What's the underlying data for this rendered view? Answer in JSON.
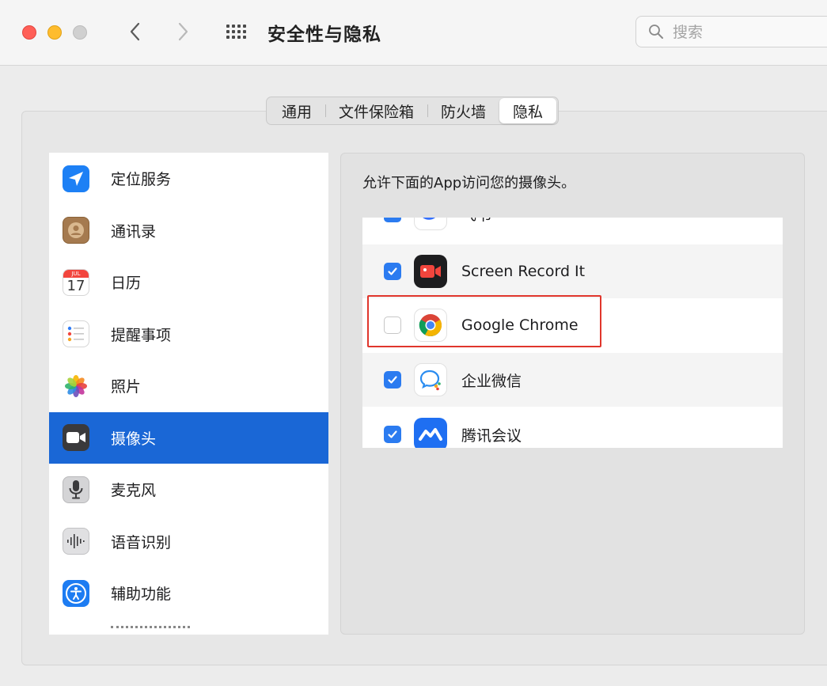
{
  "window": {
    "title": "安全性与隐私",
    "search_placeholder": "搜索"
  },
  "tabs": [
    {
      "label": "通用",
      "selected": false
    },
    {
      "label": "文件保险箱",
      "selected": false
    },
    {
      "label": "防火墙",
      "selected": false
    },
    {
      "label": "隐私",
      "selected": true
    }
  ],
  "sidebar": {
    "selected_index": 5,
    "items": [
      {
        "label": "定位服务",
        "icon": "location-arrow-icon"
      },
      {
        "label": "通讯录",
        "icon": "contacts-icon"
      },
      {
        "label": "日历",
        "icon": "calendar-icon",
        "icon_month": "JUL",
        "icon_day": "17"
      },
      {
        "label": "提醒事项",
        "icon": "reminders-icon"
      },
      {
        "label": "照片",
        "icon": "photos-icon"
      },
      {
        "label": "摄像头",
        "icon": "camera-icon"
      },
      {
        "label": "麦克风",
        "icon": "microphone-icon"
      },
      {
        "label": "语音识别",
        "icon": "speech-recognition-icon"
      },
      {
        "label": "辅助功能",
        "icon": "accessibility-icon"
      }
    ]
  },
  "panel": {
    "description": "允许下面的App访问您的摄像头。",
    "apps": [
      {
        "label": "飞书",
        "checked": true,
        "icon": "feishu-icon",
        "partially_visible": true
      },
      {
        "label": "Screen Record It",
        "checked": true,
        "icon": "screen-record-icon"
      },
      {
        "label": "Google Chrome",
        "checked": false,
        "icon": "chrome-icon",
        "highlighted": true
      },
      {
        "label": "企业微信",
        "checked": true,
        "icon": "wecom-icon"
      },
      {
        "label": "腾讯会议",
        "checked": true,
        "icon": "tencent-meeting-icon"
      }
    ]
  },
  "colors": {
    "selection_blue": "#1a67d6",
    "checkbox_blue": "#2b7bf0",
    "highlight_red": "#e0362c"
  }
}
